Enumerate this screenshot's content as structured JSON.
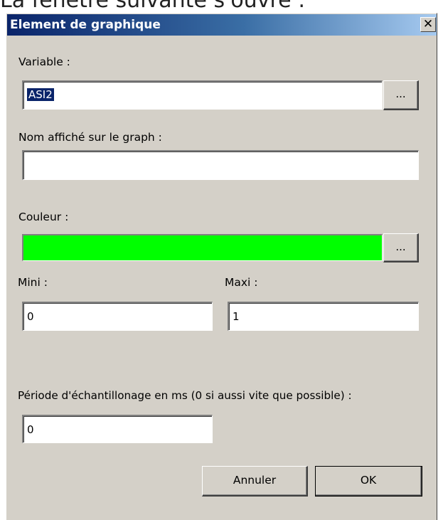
{
  "page_caption": "La fenêtre suivante s'ouvre :",
  "dialog": {
    "title": "Element de graphique",
    "close_glyph": "✕"
  },
  "variable": {
    "label": "Variable :",
    "value": "ASI2",
    "browse_label": "..."
  },
  "display_name": {
    "label": "Nom affiché sur le graph :",
    "value": ""
  },
  "color": {
    "label": "Couleur :",
    "swatch_color": "#00ff00",
    "browse_label": "..."
  },
  "mini": {
    "label": "Mini :",
    "value": "0"
  },
  "maxi": {
    "label": "Maxi :",
    "value": "1"
  },
  "sampling": {
    "label": "Période d'échantillonage en ms (0 si aussi vite que possible) :",
    "value": "0"
  },
  "buttons": {
    "cancel_label": "Annuler",
    "ok_label": "OK"
  },
  "colors": {
    "dialog_bg": "#d4d0c8",
    "titlebar_start": "#0a246a",
    "titlebar_end": "#a6caf0",
    "selection": "#0a246a"
  }
}
